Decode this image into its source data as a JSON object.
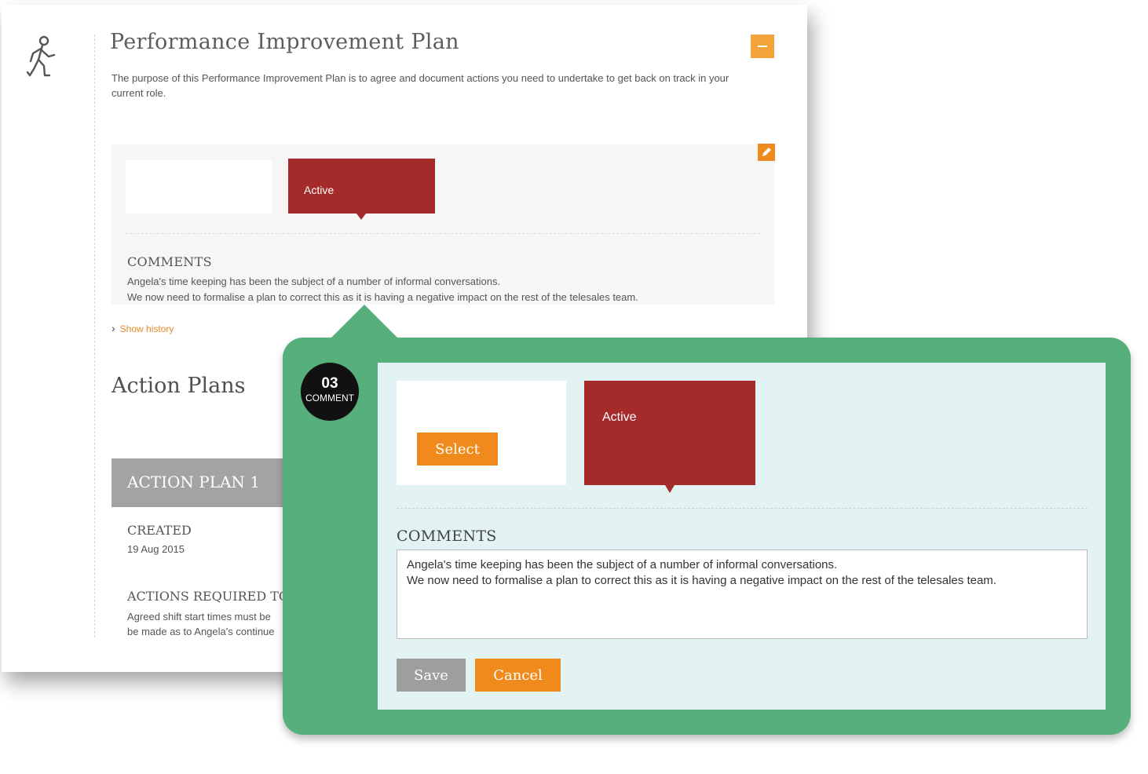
{
  "document": {
    "title": "Performance Improvement Plan",
    "description": "The purpose of this Performance Improvement Plan is to agree and document actions you need to undertake to get back on track in your current role.",
    "status": {
      "label": "Active",
      "comments_heading": "COMMENTS",
      "comment_lines": [
        "Angela's time keeping has been the subject of a number of informal conversations.",
        "We now need to formalise a plan to correct this as it is having a negative impact on the rest of the telesales team."
      ]
    },
    "show_history": "Show history",
    "action_plans": {
      "title": "Action Plans",
      "plan_title": "ACTION PLAN 1",
      "created_label": "CREATED",
      "created_value": "19 Aug 2015",
      "actions_label": "ACTIONS REQUIRED TO A",
      "actions_lines": [
        "Agreed shift start times must be",
        "be made as to Angela's continue"
      ]
    }
  },
  "overlay": {
    "badge": {
      "number": "03",
      "label": "COMMENT"
    },
    "select_button": "Select",
    "status_label": "Active",
    "comments_heading": "COMMENTS",
    "comment_text": "Angela's time keeping has been the subject of a number of informal conversations.\nWe now need to formalise a plan to correct this as it is having a negative impact on the rest of the telesales team.",
    "save_button": "Save",
    "cancel_button": "Cancel"
  },
  "colors": {
    "accent_orange": "#f08a1c",
    "status_red": "#a52a2a",
    "frame_green": "#57b07c",
    "panel_bg": "#e3f2f2"
  },
  "icons": [
    "walking-person-icon",
    "minus-icon",
    "pencil-icon",
    "chevron-right-icon"
  ]
}
